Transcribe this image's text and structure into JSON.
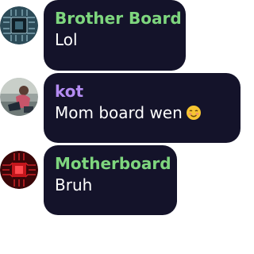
{
  "messages": [
    {
      "author": "Brother Board",
      "author_color": "#7ed67e",
      "text": "Lol",
      "avatar_icon": "circuit-board-avatar-icon"
    },
    {
      "author": "kot",
      "author_color": "#b48cf2",
      "text": "Mom board wen",
      "emoji_icon": "smiling-face-emoji-icon",
      "avatar_icon": "person-photo-avatar-icon"
    },
    {
      "author": "Motherboard",
      "author_color": "#7ed67e",
      "text": "Bruh",
      "avatar_icon": "red-circuit-avatar-icon"
    }
  ],
  "colors": {
    "bubble_bg": "#14132a",
    "message_text": "#ffffff"
  }
}
